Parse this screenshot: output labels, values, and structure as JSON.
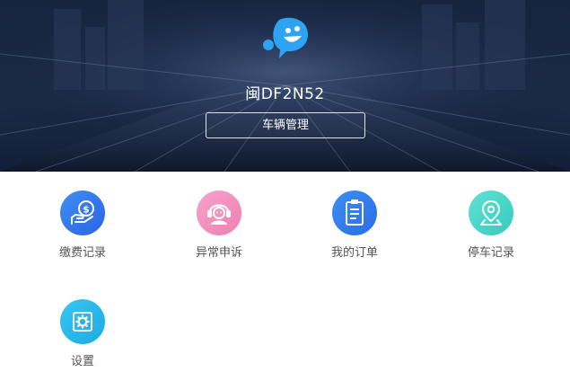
{
  "header": {
    "plate_number": "闽DF2N52",
    "manage_button_label": "车辆管理",
    "logo_icon": "chat-bubble-smile-icon"
  },
  "menu": {
    "items": [
      {
        "label": "缴费记录",
        "icon": "hand-coin-icon",
        "color": "#2f6fe8"
      },
      {
        "label": "异常申诉",
        "icon": "headset-agent-icon",
        "color": "#f08bb9"
      },
      {
        "label": "我的订单",
        "icon": "clipboard-list-icon",
        "color": "#2f74ea"
      },
      {
        "label": "停车记录",
        "icon": "map-pin-icon",
        "color": "#3fd0c4"
      },
      {
        "label": "设置",
        "icon": "gear-icon",
        "color": "#27b3ea"
      }
    ]
  },
  "colors": {
    "banner_bg": "#1b2a48",
    "logo_blue": "#2ea3f2",
    "label_text": "#555555"
  }
}
